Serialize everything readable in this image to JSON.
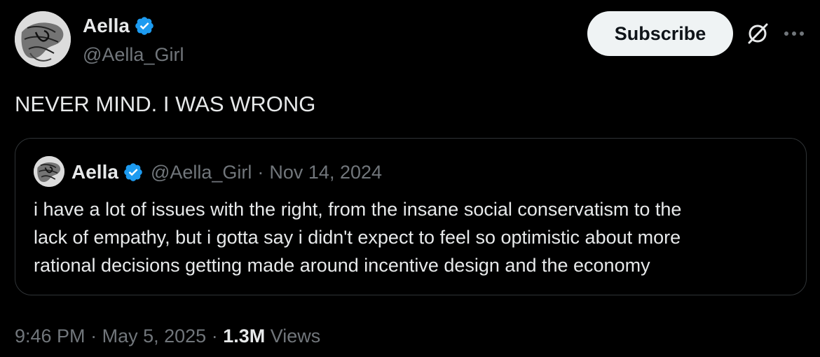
{
  "author": {
    "name": "Aella",
    "handle": "@Aella_Girl",
    "verified": true
  },
  "header_actions": {
    "subscribe_label": "Subscribe",
    "grok_icon": "grok-icon",
    "more_icon": "more-icon"
  },
  "tweet": {
    "text": "NEVER MIND. I WAS WRONG"
  },
  "quoted_tweet": {
    "name": "Aella",
    "handle": "@Aella_Girl",
    "separator": "·",
    "date": "Nov 14, 2024",
    "text_lines": [
      "i have a lot of issues with the right, from the insane social conservatism to the",
      "lack of empathy, but i gotta say i didn't expect to feel so optimistic about more",
      "rational decisions getting made around incentive design and the economy"
    ]
  },
  "meta": {
    "time": "9:46 PM",
    "separator": "·",
    "date": "May 5, 2025",
    "views_count": "1.3M",
    "views_label": "Views"
  },
  "colors": {
    "background": "#000000",
    "primary_text": "#e7e9ea",
    "secondary_text": "#71767b",
    "verified_blue": "#1d9bf0",
    "border": "#2f3336",
    "button_bg": "#eff3f4"
  }
}
